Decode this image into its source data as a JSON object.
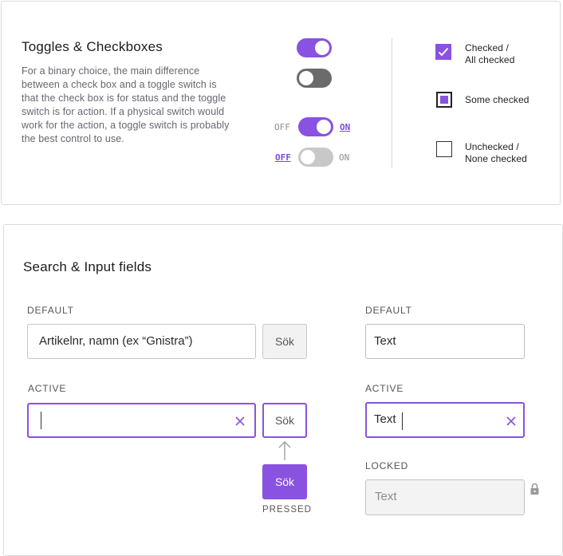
{
  "toggles_section": {
    "title": "Toggles & Checkboxes",
    "description": "For a binary choice, the main difference between a check box and a toggle switch is that the check box is for status and the toggle switch is for action. If a physical switch would work for the action, a toggle switch is probably the best control to use.",
    "toggle_on_state": "on",
    "toggle_off_state": "off",
    "labeled_on": {
      "off_label": "OFF",
      "on_label": "ON",
      "state": "on"
    },
    "labeled_off": {
      "off_label": "OFF",
      "on_label": "ON",
      "state": "off"
    },
    "checkboxes": [
      {
        "line1": "Checked /",
        "line2": "All checked",
        "state": "checked"
      },
      {
        "line1": "Some checked",
        "line2": "",
        "state": "partial"
      },
      {
        "line1": "Unchecked /",
        "line2": "None checked",
        "state": "unchecked"
      }
    ]
  },
  "search_section": {
    "title": "Search & Input fields",
    "left": {
      "default_label": "DEFAULT",
      "default_placeholder": "Artikelnr, namn (ex “Gnistra”)",
      "default_button": "Sök",
      "active_label": "ACTIVE",
      "active_value": "",
      "active_button": "Sök",
      "pressed_button": "Sök",
      "pressed_caption": "PRESSED"
    },
    "right": {
      "default_label": "DEFAULT",
      "default_value": "Text",
      "active_label": "ACTIVE",
      "active_value": "Text",
      "locked_label": "LOCKED",
      "locked_value": "Text"
    }
  },
  "colors": {
    "accent": "#8a52e0",
    "toggle_off_dark": "#6b6b6b",
    "toggle_off_light": "#c8c8c8"
  },
  "icons": [
    "check-icon",
    "clear-x-icon",
    "up-arrow-icon",
    "lock-icon"
  ]
}
